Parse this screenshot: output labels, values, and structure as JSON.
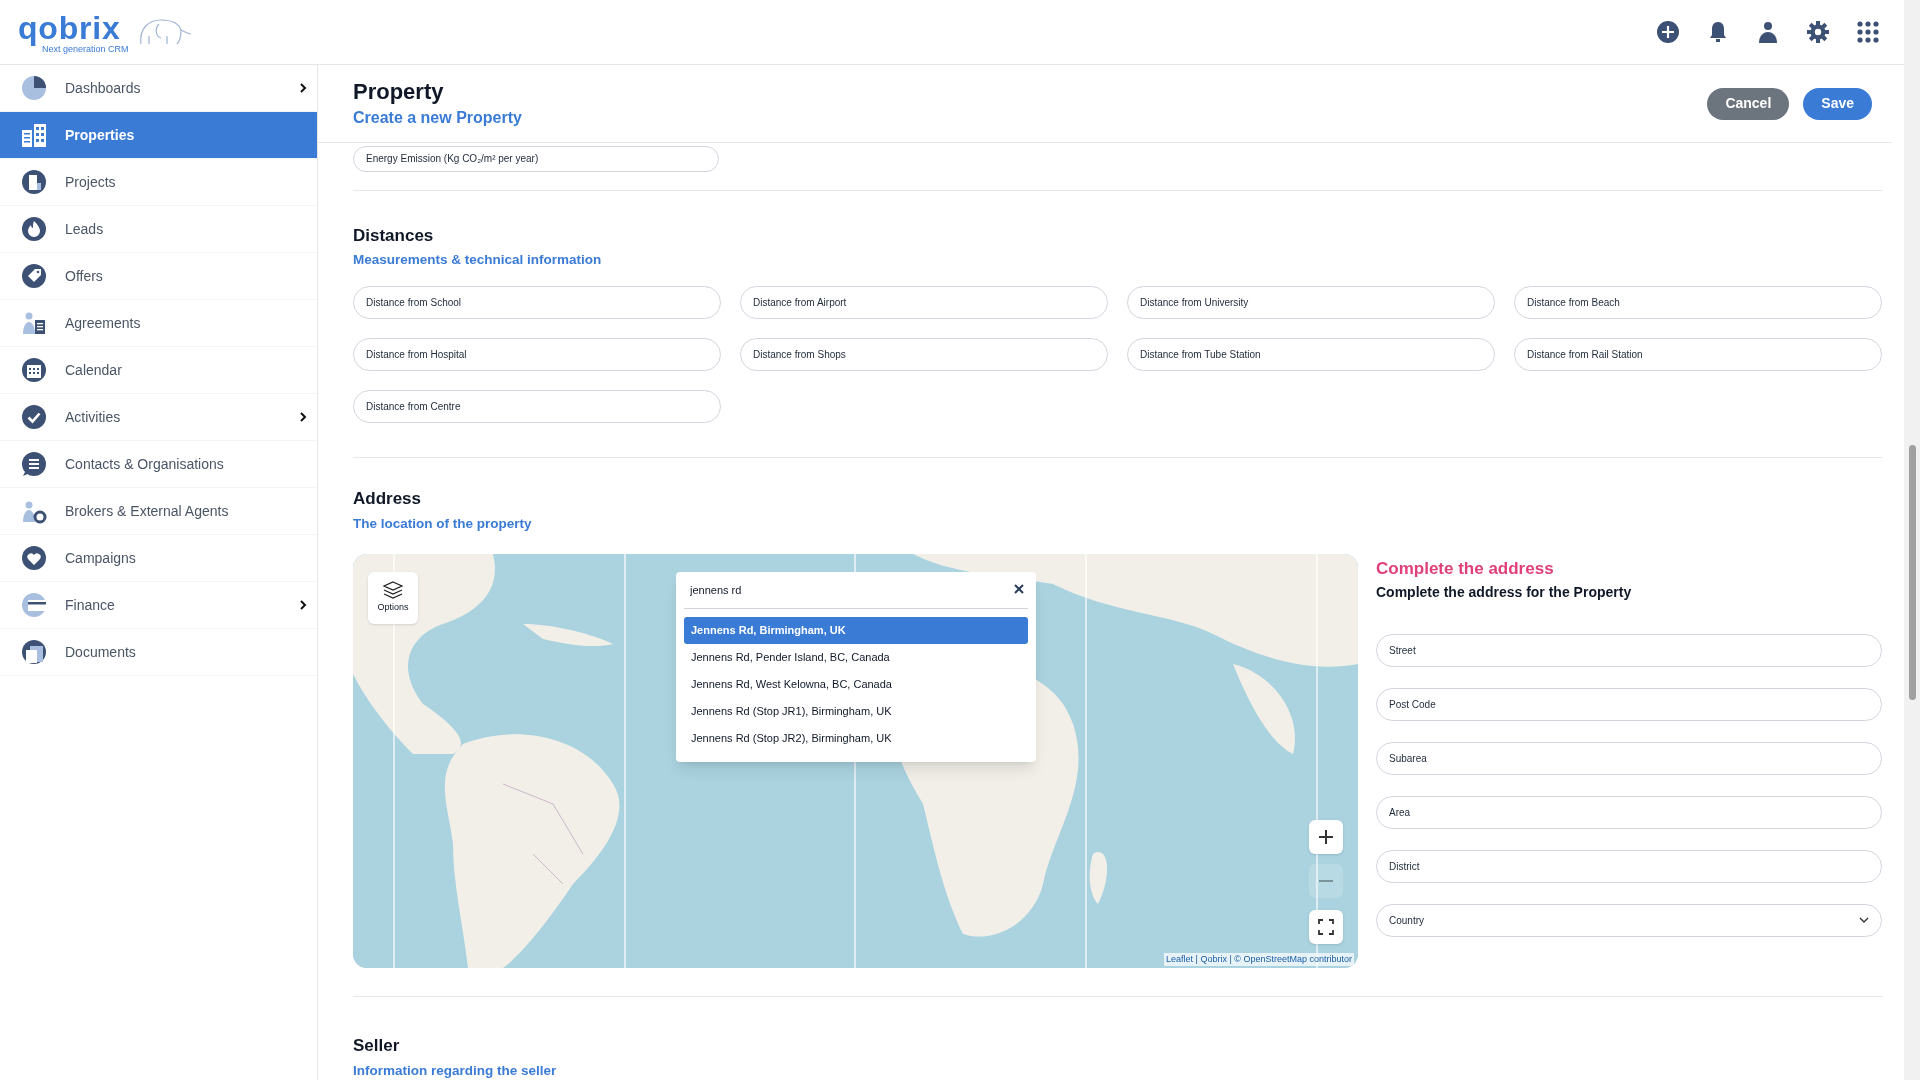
{
  "logo": {
    "name": "qobrix",
    "tagline": "Next generation CRM"
  },
  "sidebar": {
    "items": [
      {
        "label": "Dashboards",
        "selected": false,
        "expandable": true
      },
      {
        "label": "Properties",
        "selected": true,
        "expandable": false
      },
      {
        "label": "Projects",
        "selected": false,
        "expandable": false
      },
      {
        "label": "Leads",
        "selected": false,
        "expandable": false
      },
      {
        "label": "Offers",
        "selected": false,
        "expandable": false
      },
      {
        "label": "Agreements",
        "selected": false,
        "expandable": false
      },
      {
        "label": "Calendar",
        "selected": false,
        "expandable": false
      },
      {
        "label": "Activities",
        "selected": false,
        "expandable": true
      },
      {
        "label": "Contacts & Organisations",
        "selected": false,
        "expandable": false
      },
      {
        "label": "Brokers & External Agents",
        "selected": false,
        "expandable": false
      },
      {
        "label": "Campaigns",
        "selected": false,
        "expandable": false
      },
      {
        "label": "Finance",
        "selected": false,
        "expandable": true
      },
      {
        "label": "Documents",
        "selected": false,
        "expandable": false
      }
    ]
  },
  "page": {
    "title": "Property",
    "subtitle": "Create a new Property",
    "buttons": [
      {
        "label": "Cancel",
        "kind": "secondary"
      },
      {
        "label": "Save",
        "kind": "primary"
      }
    ]
  },
  "energy_field": {
    "placeholder": "Energy Emission (Kg CO₂/m² per year)"
  },
  "distances": {
    "title": "Distances",
    "subtitle": "Measurements & technical information",
    "fields": [
      {
        "placeholder": "Distance from School"
      },
      {
        "placeholder": "Distance from Airport"
      },
      {
        "placeholder": "Distance from University"
      },
      {
        "placeholder": "Distance from Beach"
      },
      {
        "placeholder": "Distance from Hospital"
      },
      {
        "placeholder": "Distance from Shops"
      },
      {
        "placeholder": "Distance from Tube Station"
      },
      {
        "placeholder": "Distance from Rail Station"
      },
      {
        "placeholder": "Distance from Centre"
      }
    ]
  },
  "address": {
    "title": "Address",
    "subtitle": "The location of the property",
    "map": {
      "options_label": "Options",
      "search": {
        "value": "jennens rd",
        "results": [
          {
            "label": "Jennens Rd, Birmingham, UK",
            "selected": true
          },
          {
            "label": "Jennens Rd, Pender Island, BC, Canada",
            "selected": false
          },
          {
            "label": "Jennens Rd, West Kelowna, BC, Canada",
            "selected": false
          },
          {
            "label": "Jennens Rd (Stop JR1), Birmingham, UK",
            "selected": false
          },
          {
            "label": "Jennens Rd (Stop JR2), Birmingham, UK",
            "selected": false
          }
        ]
      },
      "controls": [
        {
          "kind": "zoom-in",
          "disabled": false
        },
        {
          "kind": "zoom-out",
          "disabled": true
        },
        {
          "kind": "fullscreen",
          "disabled": false
        }
      ],
      "attribution": "Leaflet | Qobrix | © OpenStreetMap contributor"
    },
    "form": {
      "title": "Complete the address",
      "subtitle": "Complete the address for the Property",
      "fields": [
        {
          "placeholder": "Street",
          "kind": "text"
        },
        {
          "placeholder": "Post Code",
          "kind": "text"
        },
        {
          "placeholder": "Subarea",
          "kind": "text"
        },
        {
          "placeholder": "Area",
          "kind": "text"
        },
        {
          "placeholder": "District",
          "kind": "text"
        },
        {
          "placeholder": "Country",
          "kind": "select"
        }
      ]
    }
  },
  "seller": {
    "title": "Seller",
    "subtitle": "Information regarding the seller"
  }
}
